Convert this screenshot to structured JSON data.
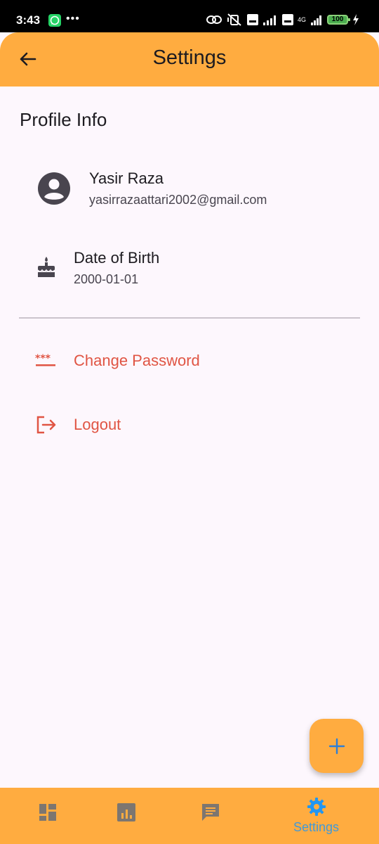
{
  "status_bar": {
    "time": "3:43",
    "dots": "•••",
    "battery": "100",
    "network": "4G"
  },
  "app_bar": {
    "title": "Settings",
    "back_icon": "arrow-back-icon"
  },
  "profile": {
    "section_title": "Profile Info",
    "name": "Yasir Raza",
    "email": "yasirrazaattari2002@gmail.com",
    "avatar_icon": "account-circle-icon",
    "dob_label": "Date of Birth",
    "dob_value": "2000-01-01",
    "dob_icon": "cake-icon"
  },
  "actions": {
    "change_password": "Change Password",
    "change_password_icon": "password-icon",
    "logout": "Logout",
    "logout_icon": "logout-icon"
  },
  "fab": {
    "icon": "plus-icon"
  },
  "bottom_nav": {
    "items": [
      {
        "label": "",
        "icon": "dashboard-icon"
      },
      {
        "label": "",
        "icon": "bar-chart-icon"
      },
      {
        "label": "",
        "icon": "chat-icon"
      },
      {
        "label": "Settings",
        "icon": "gear-icon"
      }
    ],
    "active_index": 3
  },
  "colors": {
    "accent": "#ffac40",
    "background": "#fdf7fd",
    "danger": "#e05544",
    "active_nav": "#2196f3"
  }
}
